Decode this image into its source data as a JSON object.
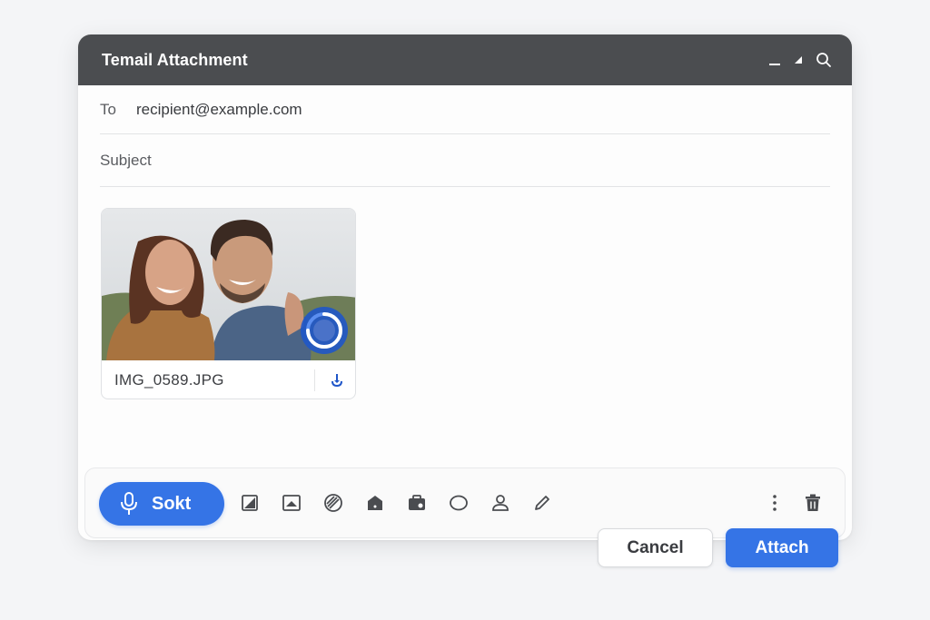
{
  "window": {
    "title": "Temail Attachment"
  },
  "compose": {
    "to_label": "To",
    "to_value": "recipient@example.com",
    "subject_label": "Subject",
    "subject_value": ""
  },
  "attachment": {
    "filename": "IMG_0589.JPG",
    "thumbnail": "photo of smiling couple outdoors",
    "upload_indicator": "spinner"
  },
  "toolbar": {
    "primary_label": "Sokt",
    "icons": [
      "resize-icon",
      "image-icon",
      "link-icon",
      "drive-icon",
      "briefcase-icon",
      "circle-icon",
      "person-icon",
      "pencil-icon"
    ],
    "right_icons": [
      "more-vertical-icon",
      "trash-icon"
    ]
  },
  "actions": {
    "cancel_label": "Cancel",
    "attach_label": "Attach"
  },
  "colors": {
    "titlebar": "#4b4d50",
    "accent": "#3574e6",
    "background": "#f4f5f7"
  }
}
